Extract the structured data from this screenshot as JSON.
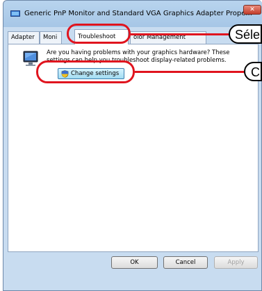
{
  "window": {
    "title": "Generic PnP Monitor and Standard VGA Graphics Adapter Prope...",
    "close_label": "✕"
  },
  "tabs": [
    {
      "label": "Adapter"
    },
    {
      "label": "Moni"
    },
    {
      "label": "Troubleshoot",
      "active": true
    },
    {
      "label": "olor Management"
    }
  ],
  "troubleshoot": {
    "description": "Are you having problems with your graphics hardware? These settings can help you troubleshoot display-related problems.",
    "change_settings_label": "Change settings"
  },
  "buttons": {
    "ok": "OK",
    "cancel": "Cancel",
    "apply": "Apply"
  },
  "callouts": {
    "tab_label": "Séle",
    "button_label": "C"
  },
  "colors": {
    "callout": "#e0141e",
    "button_accent": "#a2dcf2"
  }
}
